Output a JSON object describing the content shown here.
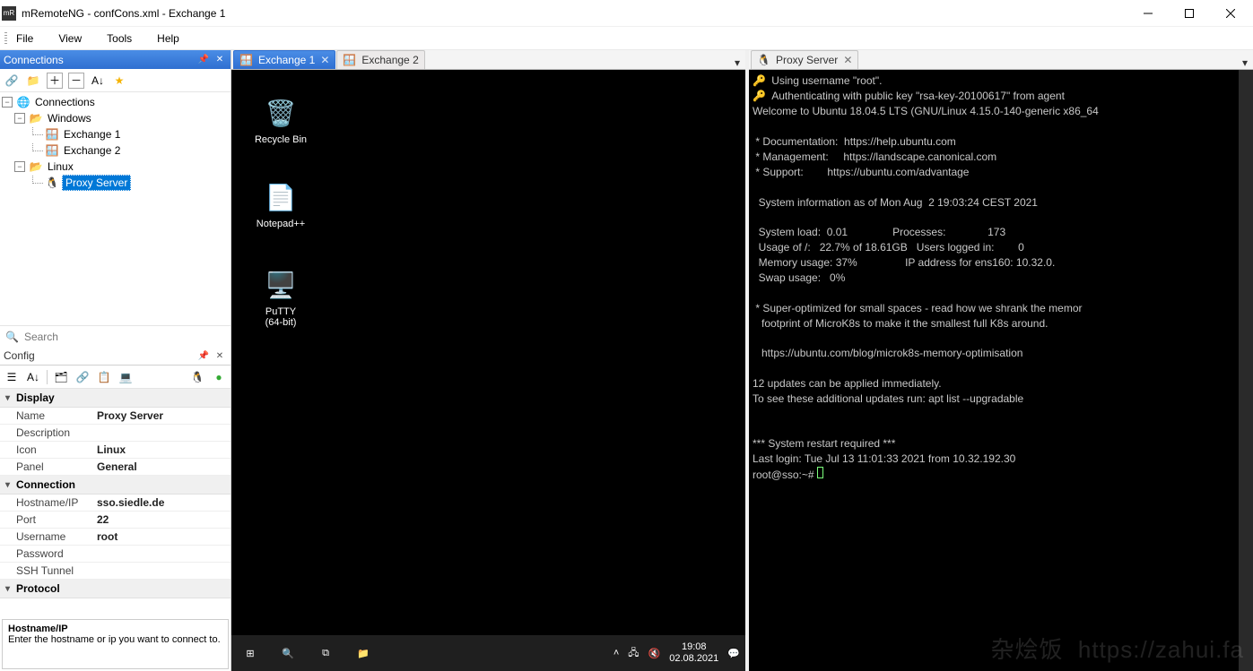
{
  "window": {
    "title": "mRemoteNG - confCons.xml - Exchange 1"
  },
  "menu": [
    "File",
    "View",
    "Tools",
    "Help"
  ],
  "panels": {
    "connections": {
      "title": "Connections",
      "search_placeholder": "Search"
    },
    "config": {
      "title": "Config",
      "help_title": "Hostname/IP",
      "help_text": "Enter the hostname or ip you want to connect to."
    }
  },
  "tree": {
    "root": "Connections",
    "folders": [
      {
        "name": "Windows",
        "children": [
          "Exchange 1",
          "Exchange 2"
        ]
      },
      {
        "name": "Linux",
        "children": [
          "Proxy Server"
        ]
      }
    ]
  },
  "config_props": {
    "display": {
      "Name": "Proxy Server",
      "Description": "",
      "Icon": "Linux",
      "Panel": "General"
    },
    "connection": {
      "Hostname/IP": "sso.siedle.de",
      "Port": "22",
      "Username": "root",
      "Password": "",
      "SSH Tunnel": ""
    },
    "protocol": {}
  },
  "tabs": {
    "rdp": [
      {
        "label": "Exchange 1",
        "active": true,
        "closable": true
      },
      {
        "label": "Exchange 2",
        "active": false,
        "closable": false
      }
    ],
    "ssh": [
      {
        "label": "Proxy Server",
        "active": true
      }
    ]
  },
  "desktop": {
    "icons": [
      {
        "name": "Recycle Bin",
        "emoji": "🗑"
      },
      {
        "name": "Notepad++",
        "emoji": "📝"
      },
      {
        "name": "PuTTY\n(64-bit)",
        "emoji": "🖥"
      }
    ],
    "time": "19:08",
    "date": "02.08.2021"
  },
  "terminal": {
    "line1": "Using username \"root\".",
    "line2": "Authenticating with public key \"rsa-key-20100617\" from agent",
    "welcome": "Welcome to Ubuntu 18.04.5 LTS (GNU/Linux 4.15.0-140-generic x86_64",
    "doc": " * Documentation:  https://help.ubuntu.com",
    "mgmt": " * Management:     https://landscape.canonical.com",
    "supp": " * Support:        https://ubuntu.com/advantage",
    "sysinfo": "  System information as of Mon Aug  2 19:03:24 CEST 2021",
    "load": "  System load:  0.01               Processes:              173",
    "usage": "  Usage of /:   22.7% of 18.61GB   Users logged in:        0",
    "mem": "  Memory usage: 37%                IP address for ens160: 10.32.0.",
    "swap": "  Swap usage:   0%",
    "super1": " * Super-optimized for small spaces - read how we shrank the memor",
    "super2": "   footprint of MicroK8s to make it the smallest full K8s around.",
    "blog": "   https://ubuntu.com/blog/microk8s-memory-optimisation",
    "upd1": "12 updates can be applied immediately.",
    "upd2": "To see these additional updates run: apt list --upgradable",
    "restart": "*** System restart required ***",
    "last": "Last login: Tue Jul 13 11:01:33 2021 from 10.32.192.30",
    "prompt": "root@sso:~# "
  },
  "watermark": "杂烩饭  https://zahui.fa"
}
